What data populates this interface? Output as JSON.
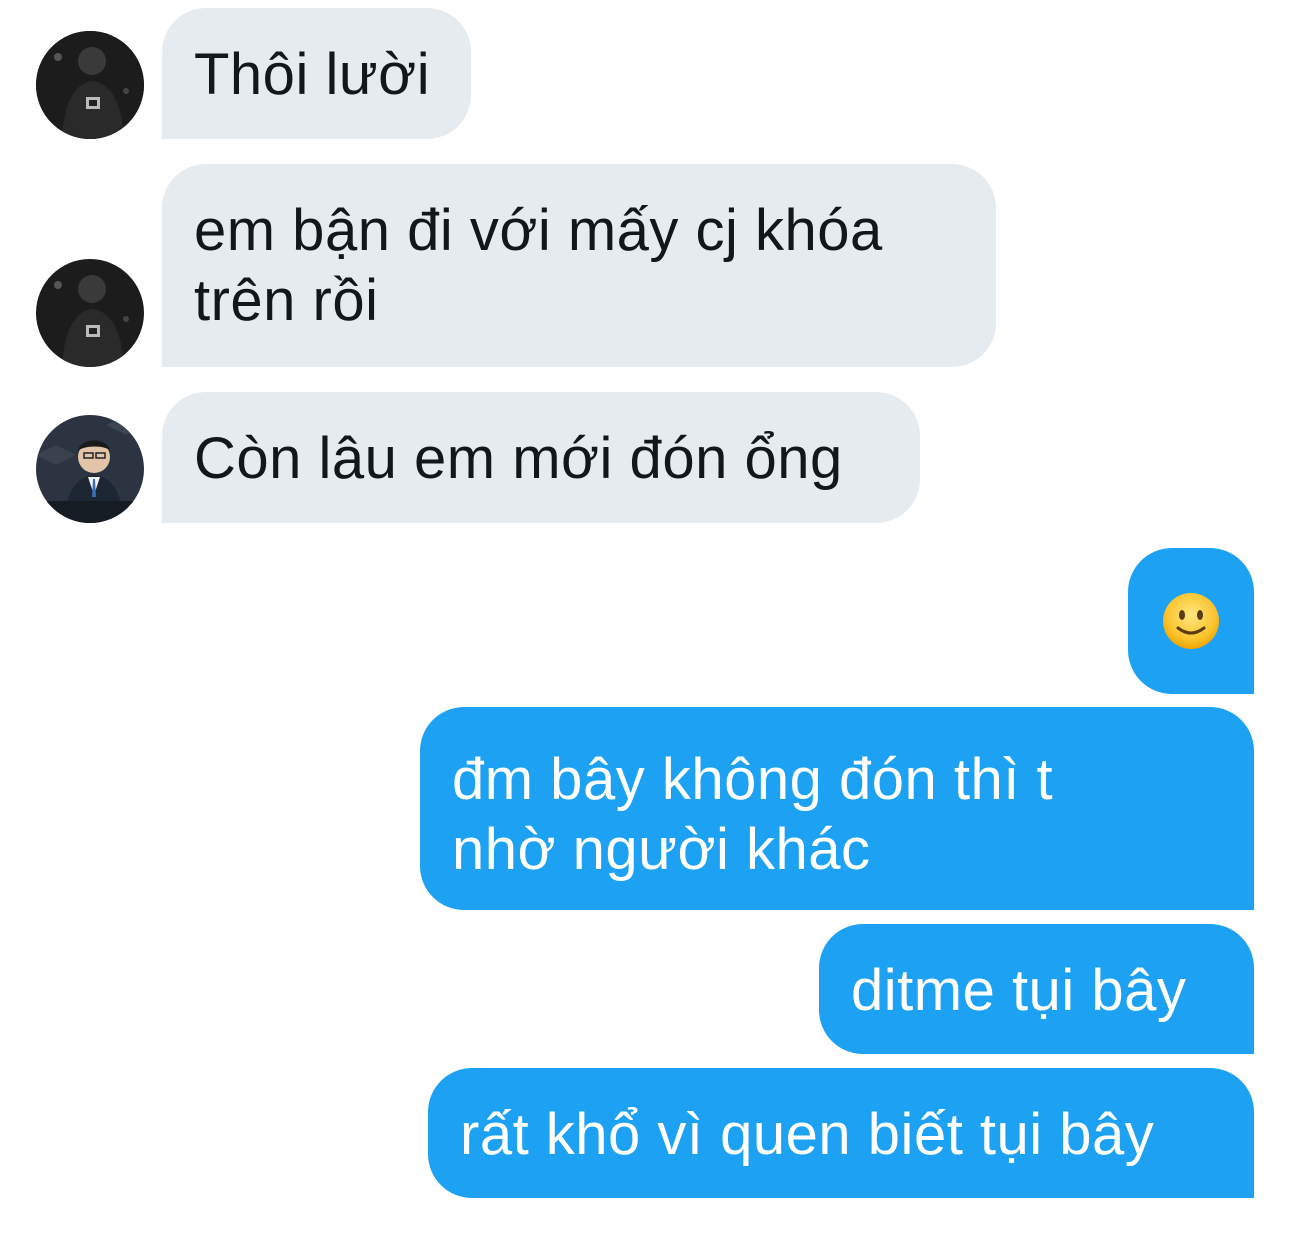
{
  "conversation": {
    "messages": [
      {
        "sender": "other",
        "avatar": "avatar-player",
        "text": "Thôi lười"
      },
      {
        "sender": "other",
        "avatar": "avatar-player",
        "text": "em bận đi với mấy cj khóa trên rồi"
      },
      {
        "sender": "other",
        "avatar": "avatar-man-suit",
        "text": "Còn lâu em mới đón ổng"
      },
      {
        "sender": "me",
        "emoji": "slightly-smiling-face-icon",
        "text": ""
      },
      {
        "sender": "me",
        "text": "đm bây không đón thì t nhờ người khác"
      },
      {
        "sender": "me",
        "text": "ditme tụi bây"
      },
      {
        "sender": "me",
        "text": "rất khổ vì quen biết tụi bây"
      }
    ]
  },
  "colors": {
    "incoming_bubble": "#e6ebf0",
    "outgoing_bubble": "#1da1f2",
    "incoming_text": "#14171a",
    "outgoing_text": "#ffffff"
  }
}
